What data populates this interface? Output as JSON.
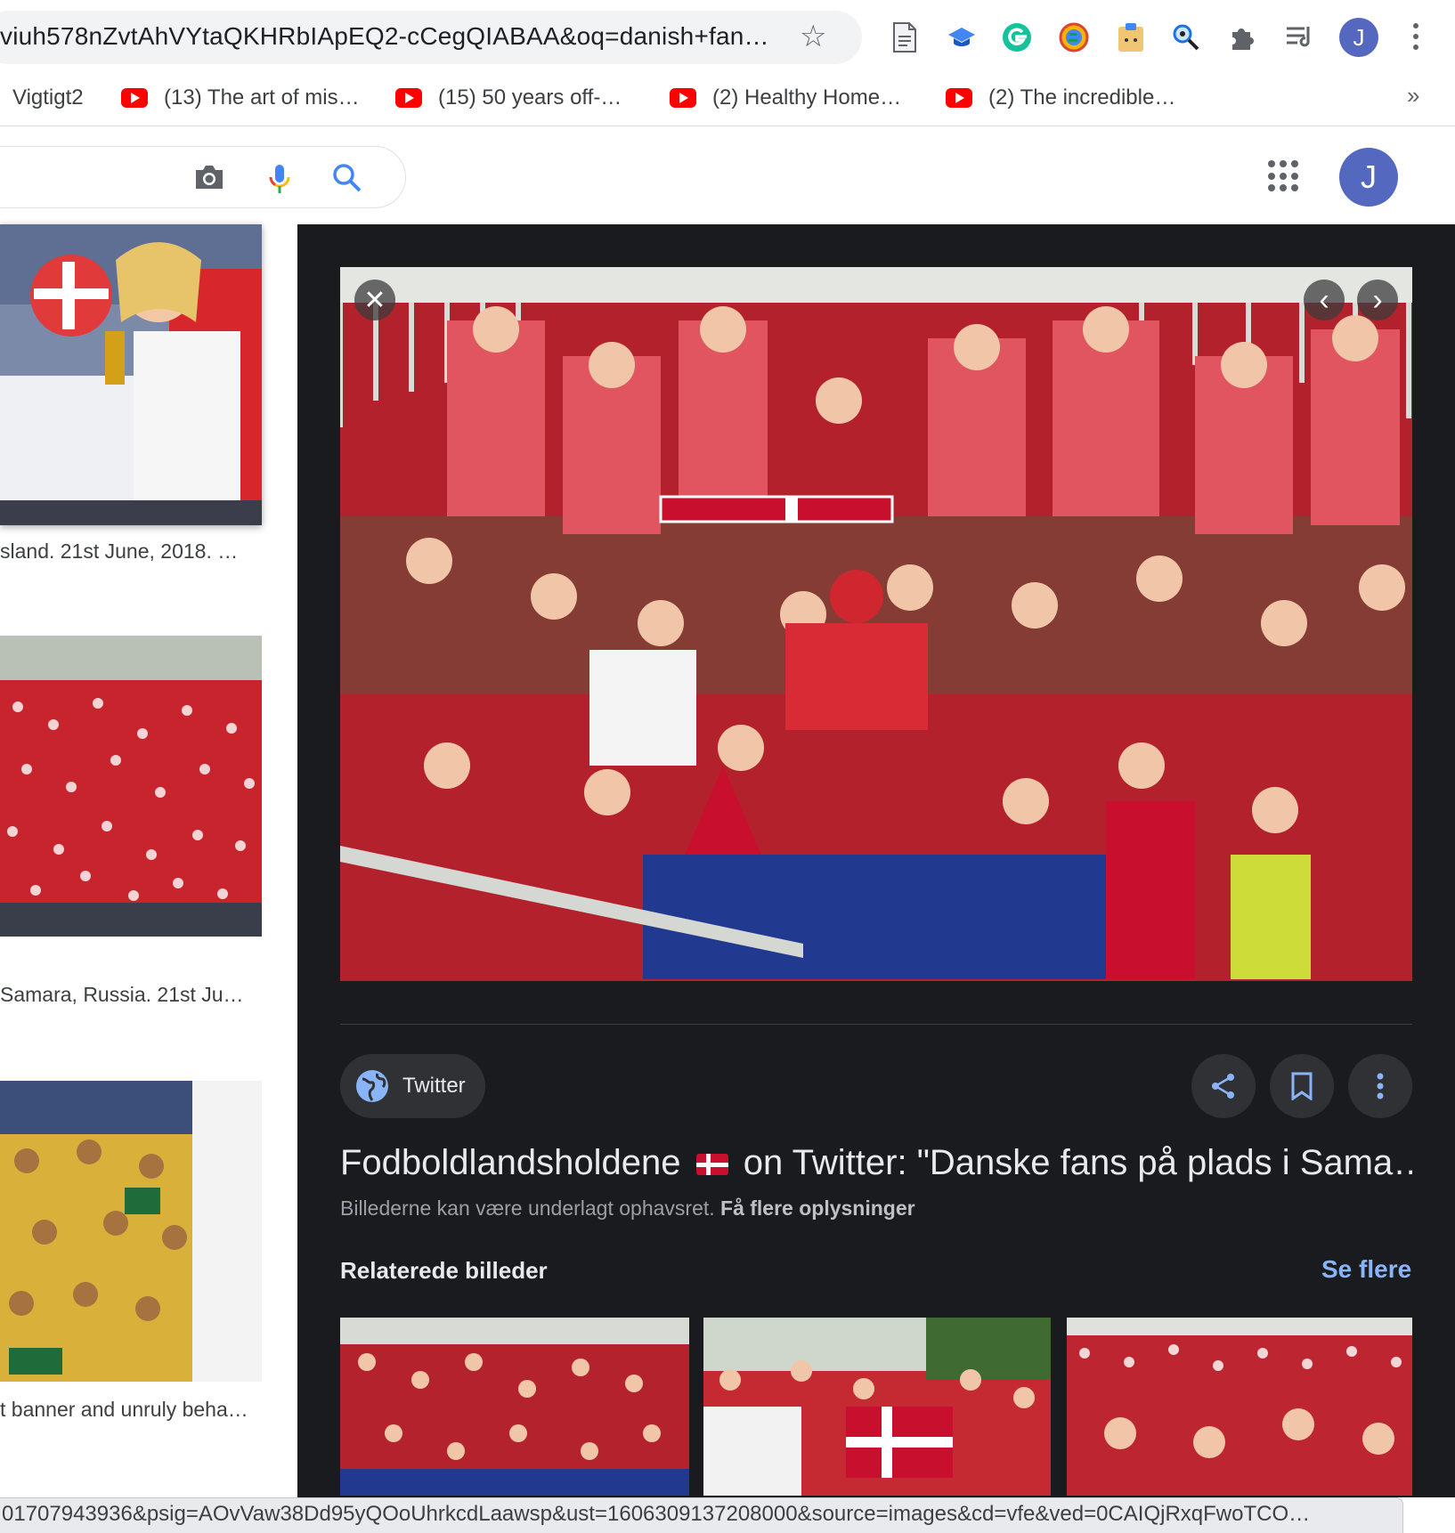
{
  "browser": {
    "url": "viuh578nZvtAhVYtaQKHRbIApEQ2-cCegQIABAA&oq=danish+fan…",
    "profile_initial": "J",
    "bookmarks": [
      {
        "label": "Vigtigt2",
        "icon": "folder-icon"
      },
      {
        "label": "(13) The art of mis…",
        "icon": "youtube-icon"
      },
      {
        "label": "(15) 50 years off-…",
        "icon": "youtube-icon"
      },
      {
        "label": "(2) Healthy Home…",
        "icon": "youtube-icon"
      },
      {
        "label": "(2) The incredible…",
        "icon": "youtube-icon"
      }
    ],
    "bookmarks_overflow": "»",
    "status_url": "01707943936&psig=AOvVaw38Dd95yQOoUhrkcdLaawsp&ust=1606309137208000&source=images&cd=vfe&ved=0CAIQjRxqFwoTCO…"
  },
  "google": {
    "profile_initial": "J"
  },
  "results": [
    {
      "caption": "sland. 21st June, 2018. …"
    },
    {
      "caption": "Samara, Russia. 21st Ju…"
    },
    {
      "caption": "t banner and unruly beha…"
    }
  ],
  "preview": {
    "source": "Twitter",
    "title_prefix": "Fodboldlandsholdene",
    "title_suffix": "on Twitter: \"Danske fans på plads i Sama…",
    "copyright": "Billederne kan være underlagt ophavsret.",
    "more_info": "Få flere oplysninger",
    "related_heading": "Relaterede billeder",
    "see_more": "Se flere"
  },
  "colors": {
    "panel_bg": "#1a1b1f",
    "accent_link": "#8ab4f8",
    "danish_red": "#c8102e"
  }
}
